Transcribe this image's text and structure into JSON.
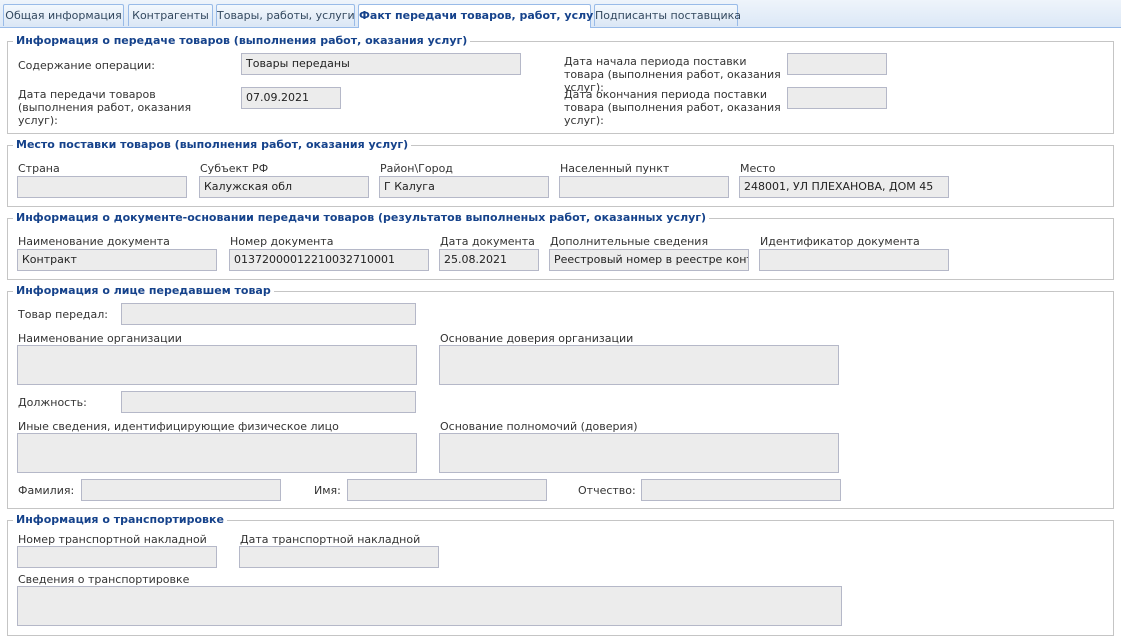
{
  "tabs": [
    {
      "label": "Общая информация"
    },
    {
      "label": "Контрагенты"
    },
    {
      "label": "Товары, работы, услуги"
    },
    {
      "label": "Факт передачи товаров, работ, услуг"
    },
    {
      "label": "Подписанты поставщика"
    }
  ],
  "active_tab": "Факт передачи товаров, работ, услуг",
  "transfer": {
    "legend": "Информация о передаче товаров (выполнения работ, оказания услуг)",
    "operation_label": "Содержание операции:",
    "operation_value": "Товары переданы",
    "transfer_date_label": "Дата передачи товаров (выполнения работ, оказания услуг):",
    "transfer_date_value": "07.09.2021",
    "period_start_label": "Дата начала периода поставки товара (выполнения работ, оказания услуг):",
    "period_start_value": "",
    "period_end_label": "Дата окончания периода поставки товара (выполнения работ, оказания услуг):",
    "period_end_value": ""
  },
  "delivery_place": {
    "legend": "Место поставки товаров (выполнения работ, оказания услуг)",
    "country_label": "Страна",
    "country_value": "",
    "region_label": "Субъект РФ",
    "region_value": "Калужская обл",
    "district_label": "Район\\Город",
    "district_value": "Г Калуга",
    "locality_label": "Населенный пункт",
    "locality_value": "",
    "place_label": "Место",
    "place_value": "248001, УЛ ПЛЕХАНОВА, ДОМ 45"
  },
  "basis_doc": {
    "legend": "Информация о документе-основании передачи товаров (результатов выполненых работ, оказанных услуг)",
    "name_label": "Наименование документа",
    "name_value": "Контракт",
    "number_label": "Номер документа",
    "number_value": "0137200001221003271000​1",
    "date_label": "Дата документа",
    "date_value": "25.08.2021",
    "extra_label": "Дополнительные сведения",
    "extra_value": "Реестровый номер в реестре контр",
    "id_label": "Идентификатор документа",
    "id_value": ""
  },
  "transferor": {
    "legend": "Информация о лице передавшем товар",
    "by_label": "Товар передал:",
    "by_value": "",
    "org_name_label": "Наименование организации",
    "org_name_value": "",
    "org_trust_label": "Основание доверия организации",
    "org_trust_value": "",
    "position_label": "Должность:",
    "position_value": "",
    "other_info_label": "Иные сведения, идентифицирующие физическое лицо",
    "other_info_value": "",
    "authority_label": "Основание полномочий (доверия)",
    "authority_value": "",
    "last_name_label": "Фамилия:",
    "last_name_value": "",
    "first_name_label": "Имя:",
    "first_name_value": "",
    "patronymic_label": "Отчество:",
    "patronymic_value": ""
  },
  "transport": {
    "legend": "Информация о транспортировке",
    "waybill_number_label": "Номер транспортной накладной",
    "waybill_number_value": "",
    "waybill_date_label": "Дата транспортной накладной",
    "waybill_date_value": "",
    "info_label": "Сведения о транспортировке",
    "info_value": ""
  }
}
